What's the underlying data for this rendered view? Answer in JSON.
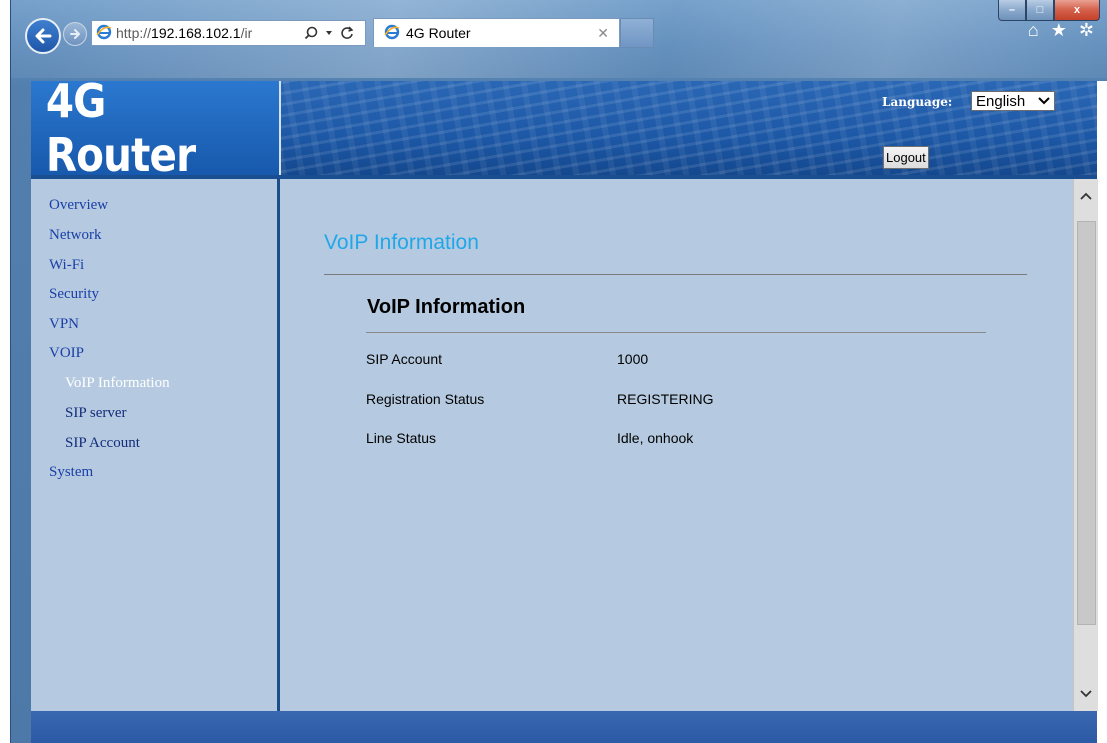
{
  "browser": {
    "url_prefix": "http://",
    "url_host": "192.168.102.1",
    "url_suffix": "/ir",
    "tab_title": "4G Router",
    "window_buttons": {
      "minimize": "–",
      "maximize": "□",
      "close": "x"
    }
  },
  "header": {
    "logo_text": "4G Router",
    "language_label": "Language:",
    "language_selected": "English",
    "logout_label": "Logout"
  },
  "sidebar": {
    "items": [
      {
        "label": "Overview"
      },
      {
        "label": "Network"
      },
      {
        "label": "Wi-Fi"
      },
      {
        "label": "Security"
      },
      {
        "label": "VPN"
      },
      {
        "label": "VOIP"
      },
      {
        "label": "VoIP Information"
      },
      {
        "label": "SIP server"
      },
      {
        "label": "SIP Account"
      },
      {
        "label": "System"
      }
    ]
  },
  "main": {
    "page_title": "VoIP Information",
    "section_title": "VoIP Information",
    "rows": [
      {
        "label": "SIP Account",
        "value": "1000"
      },
      {
        "label": "Registration Status",
        "value": "REGISTERING"
      },
      {
        "label": "Line Status",
        "value": "Idle, onhook"
      }
    ]
  },
  "colors": {
    "accent_heading": "#21a7e8",
    "nav_link": "#1a3fa6",
    "nav_active": "#ffffff",
    "content_bg": "#b5cae0",
    "banner": "#1f5fb0"
  }
}
